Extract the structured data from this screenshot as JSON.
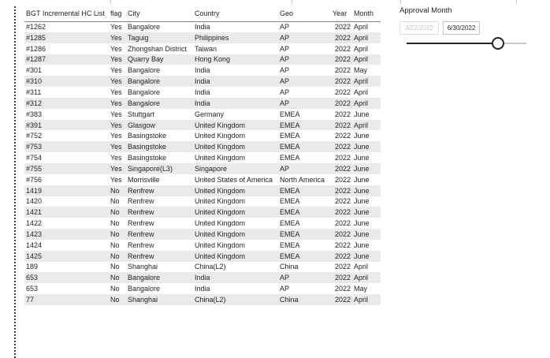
{
  "table": {
    "columns": [
      "BGT Incremental HC List",
      "flag",
      "City",
      "Country",
      "Geo",
      "Year",
      "Month"
    ],
    "rows": [
      [
        "#1262",
        "Yes",
        "Bangalore",
        "India",
        "AP",
        "2022",
        "April"
      ],
      [
        "#1285",
        "Yes",
        "Taguig",
        "Philippines",
        "AP",
        "2022",
        "April"
      ],
      [
        "#1286",
        "Yes",
        "Zhongshan District",
        "Taiwan",
        "AP",
        "2022",
        "April"
      ],
      [
        "#1287",
        "Yes",
        "Quarry Bay",
        "Hong Kong",
        "AP",
        "2022",
        "April"
      ],
      [
        "#301",
        "Yes",
        "Bangalore",
        "India",
        "AP",
        "2022",
        "May"
      ],
      [
        "#310",
        "Yes",
        "Bangalore",
        "India",
        "AP",
        "2022",
        "April"
      ],
      [
        "#311",
        "Yes",
        "Bangalore",
        "India",
        "AP",
        "2022",
        "April"
      ],
      [
        "#312",
        "Yes",
        "Bangalore",
        "India",
        "AP",
        "2022",
        "April"
      ],
      [
        "#383",
        "Yes",
        "Stuttgart",
        "Germany",
        "EMEA",
        "2022",
        "June"
      ],
      [
        "#391",
        "Yes",
        "Glasgow",
        "United Kingdom",
        "EMEA",
        "2022",
        "April"
      ],
      [
        "#752",
        "Yes",
        "Basingstoke",
        "United Kingdom",
        "EMEA",
        "2022",
        "June"
      ],
      [
        "#753",
        "Yes",
        "Basingstoke",
        "United Kingdom",
        "EMEA",
        "2022",
        "June"
      ],
      [
        "#754",
        "Yes",
        "Basingstoke",
        "United Kingdom",
        "EMEA",
        "2022",
        "June"
      ],
      [
        "#755",
        "Yes",
        "Singapore(L3)",
        "Singapore",
        "AP",
        "2022",
        "June"
      ],
      [
        "#756",
        "Yes",
        "Morrisville",
        "United States of America",
        "North America",
        "2022",
        "June"
      ],
      [
        "1419",
        "No",
        "Renfrew",
        "United Kingdom",
        "EMEA",
        "2022",
        "June"
      ],
      [
        "1420",
        "No",
        "Renfrew",
        "United Kingdom",
        "EMEA",
        "2022",
        "June"
      ],
      [
        "1421",
        "No",
        "Renfrew",
        "United Kingdom",
        "EMEA",
        "2022",
        "June"
      ],
      [
        "1422",
        "No",
        "Renfrew",
        "United Kingdom",
        "EMEA",
        "2022",
        "June"
      ],
      [
        "1423",
        "No",
        "Renfrew",
        "United Kingdom",
        "EMEA",
        "2022",
        "June"
      ],
      [
        "1424",
        "No",
        "Renfrew",
        "United Kingdom",
        "EMEA",
        "2022",
        "June"
      ],
      [
        "1425",
        "No",
        "Renfrew",
        "United Kingdom",
        "EMEA",
        "2022",
        "June"
      ],
      [
        "189",
        "No",
        "Shanghai",
        "China(L2)",
        "China",
        "2022",
        "April"
      ],
      [
        "653",
        "No",
        "Bangalore",
        "India",
        "AP",
        "2022",
        "April"
      ],
      [
        "653",
        "No",
        "Bangalore",
        "India",
        "AP",
        "2022",
        "May"
      ],
      [
        "77",
        "No",
        "Shanghai",
        "China(L2)",
        "China",
        "2022",
        "April"
      ]
    ]
  },
  "slicer": {
    "title": "Approval Month",
    "start_date": "4/22/2022",
    "end_date": "6/30/2022",
    "range_start_fraction": 0,
    "range_end_fraction": 0.76
  },
  "colors": {
    "header_underline": "#4a8ec7",
    "row_band": "#eaeaea",
    "slider_fill": "#252423"
  }
}
